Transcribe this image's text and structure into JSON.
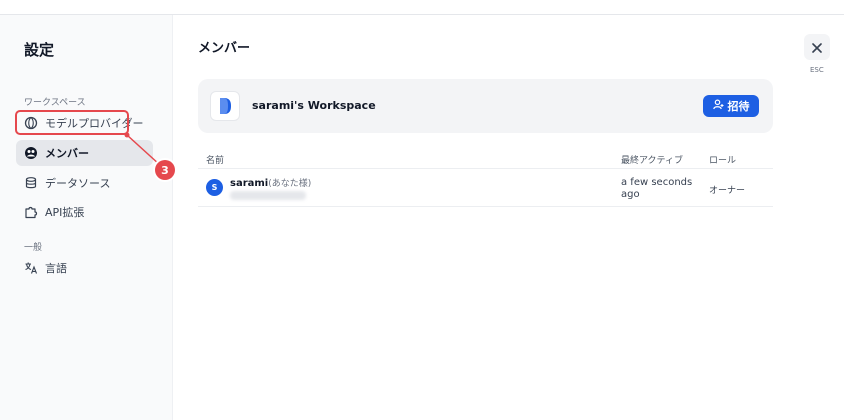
{
  "sidebar": {
    "title": "設定",
    "sections": [
      {
        "label": "ワークスペース"
      },
      {
        "label": "一般"
      }
    ],
    "items": [
      {
        "label": "モデルプロバイダー",
        "icon": "model-provider-icon"
      },
      {
        "label": "メンバー",
        "icon": "members-icon",
        "active": true
      },
      {
        "label": "データソース",
        "icon": "database-icon"
      },
      {
        "label": "API拡張",
        "icon": "puzzle-icon"
      },
      {
        "label": "言語",
        "icon": "translate-icon"
      }
    ]
  },
  "annotation": {
    "number": "3",
    "color": "#e5484d"
  },
  "main": {
    "title": "メンバー",
    "workspace": {
      "name": "sarami's Workspace"
    },
    "invite_label": "招待",
    "table": {
      "headers": [
        "名前",
        "最終アクティブ",
        "ロール"
      ],
      "rows": [
        {
          "avatar": "S",
          "name": "sarami",
          "you": "(あなた様)",
          "last_active": "a few seconds ago",
          "role": "オーナー"
        }
      ]
    }
  },
  "close": {
    "label": "ESC"
  },
  "colors": {
    "accent": "#1d5fe3",
    "annotation": "#e5484d"
  }
}
